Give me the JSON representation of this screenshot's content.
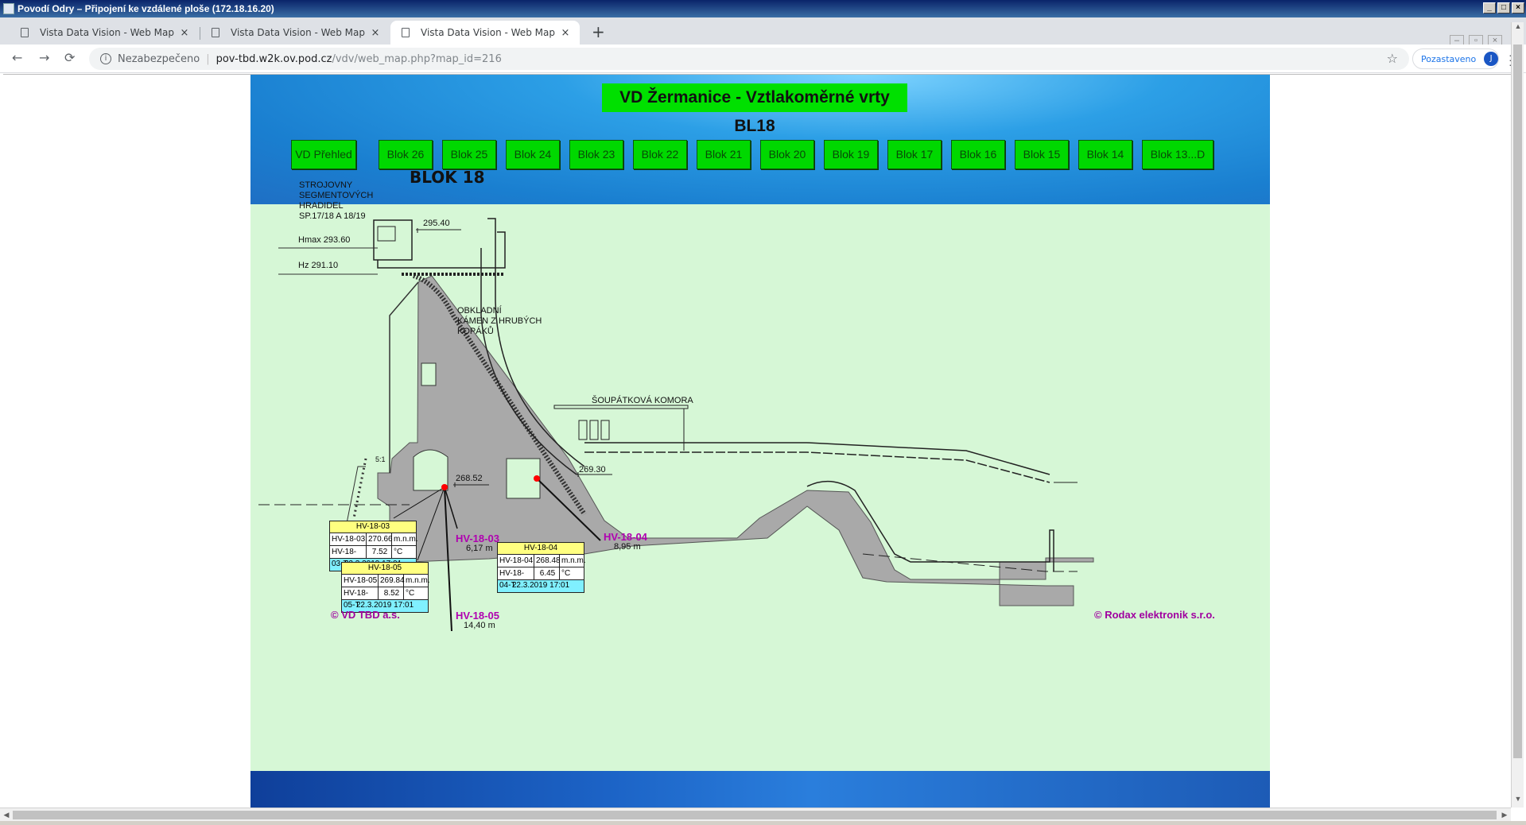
{
  "window": {
    "title": "Povodí Odry – Připojení ke vzdálené ploše (172.18.16.20)",
    "buttons": [
      "_",
      "□",
      "×"
    ]
  },
  "browser": {
    "tabs": [
      {
        "title": "Vista Data Vision - Web Map",
        "close": "×",
        "active": false
      },
      {
        "title": "Vista Data Vision - Web Map",
        "close": "×",
        "active": false
      },
      {
        "title": "Vista Data Vision - Web Map",
        "close": "×",
        "active": true
      }
    ],
    "new_tab": "+",
    "nav": {
      "back": "←",
      "forward": "→",
      "reload": "⟳"
    },
    "omnibox": {
      "security_label": "Nezabezpečeno",
      "url_host": "pov-tbd.w2k.ov.pod.cz",
      "url_path": "/vdv/web_map.php?map_id=216",
      "info_icon": "i",
      "star_icon": "☆"
    },
    "profile": {
      "label": "Pozastaveno",
      "initial": "J"
    }
  },
  "page": {
    "title": "VD Žermanice - Vztlakoměrné vrty BL18",
    "nav_links": [
      "VD Přehled",
      "Blok 26",
      "Blok 25",
      "Blok 24",
      "Blok 23",
      "Blok 22",
      "Blok 21",
      "Blok 20",
      "Blok 19",
      "Blok 17",
      "Blok 16",
      "Blok 15",
      "Blok 14",
      "Blok 13...D"
    ]
  },
  "drawing": {
    "block_title": "BLOK 18",
    "labels": {
      "strojovny": "STROJOVNY\nSEGMENTOVÝCH\nHRADIDEL\nSP.17/18 A 18/19",
      "hmax": "Hmax 293.60",
      "hz": "Hz 291.10",
      "elev_295": "295.40",
      "obkladni": "OBKLADNÍ\nKÁMEN Z HRUBÝCH\nKOPÁKŮ",
      "soupatkova": "ŠOUPÁTKOVÁ KOMORA",
      "elev_268": "268.52",
      "elev_269": "269.30",
      "small_51": "5:1"
    },
    "probes": [
      {
        "name": "HV-18-03",
        "depth": "6,17 m"
      },
      {
        "name": "HV-18-04",
        "depth": "8,95 m"
      },
      {
        "name": "HV-18-05",
        "depth": "14,40 m"
      }
    ],
    "tables": {
      "t03": {
        "header": "HV-18-03",
        "rows": [
          [
            "HV-18-03",
            "270.66",
            "m.n.m."
          ],
          [
            "HV-18-03-T",
            "7.52",
            "°C"
          ]
        ],
        "timestamp": "22.3.2019 17:01"
      },
      "t05": {
        "header": "HV-18-05",
        "rows": [
          [
            "HV-18-05",
            "269.84",
            "m.n.m."
          ],
          [
            "HV-18-05-T",
            "8.52",
            "°C"
          ]
        ],
        "timestamp": "22.3.2019 17:01"
      },
      "t04": {
        "header": "HV-18-04",
        "rows": [
          [
            "HV-18-04",
            "268.48",
            "m.n.m."
          ],
          [
            "HV-18-04-T",
            "6.45",
            "°C"
          ]
        ],
        "timestamp": "22.3.2019 17:01"
      }
    },
    "credits": {
      "left": "© VD TBD a.s.",
      "right": "© Rodax elektronik s.r.o."
    }
  },
  "colors": {
    "header_blue": "#2c9fe6",
    "nav_green": "#00d800",
    "drawing_bg": "#d6f7d6",
    "dam_gray": "#a9a9a9",
    "probe_magenta": "#b000b0",
    "table_header_yellow": "#ffff80",
    "table_ts_cyan": "#80f0ff"
  }
}
